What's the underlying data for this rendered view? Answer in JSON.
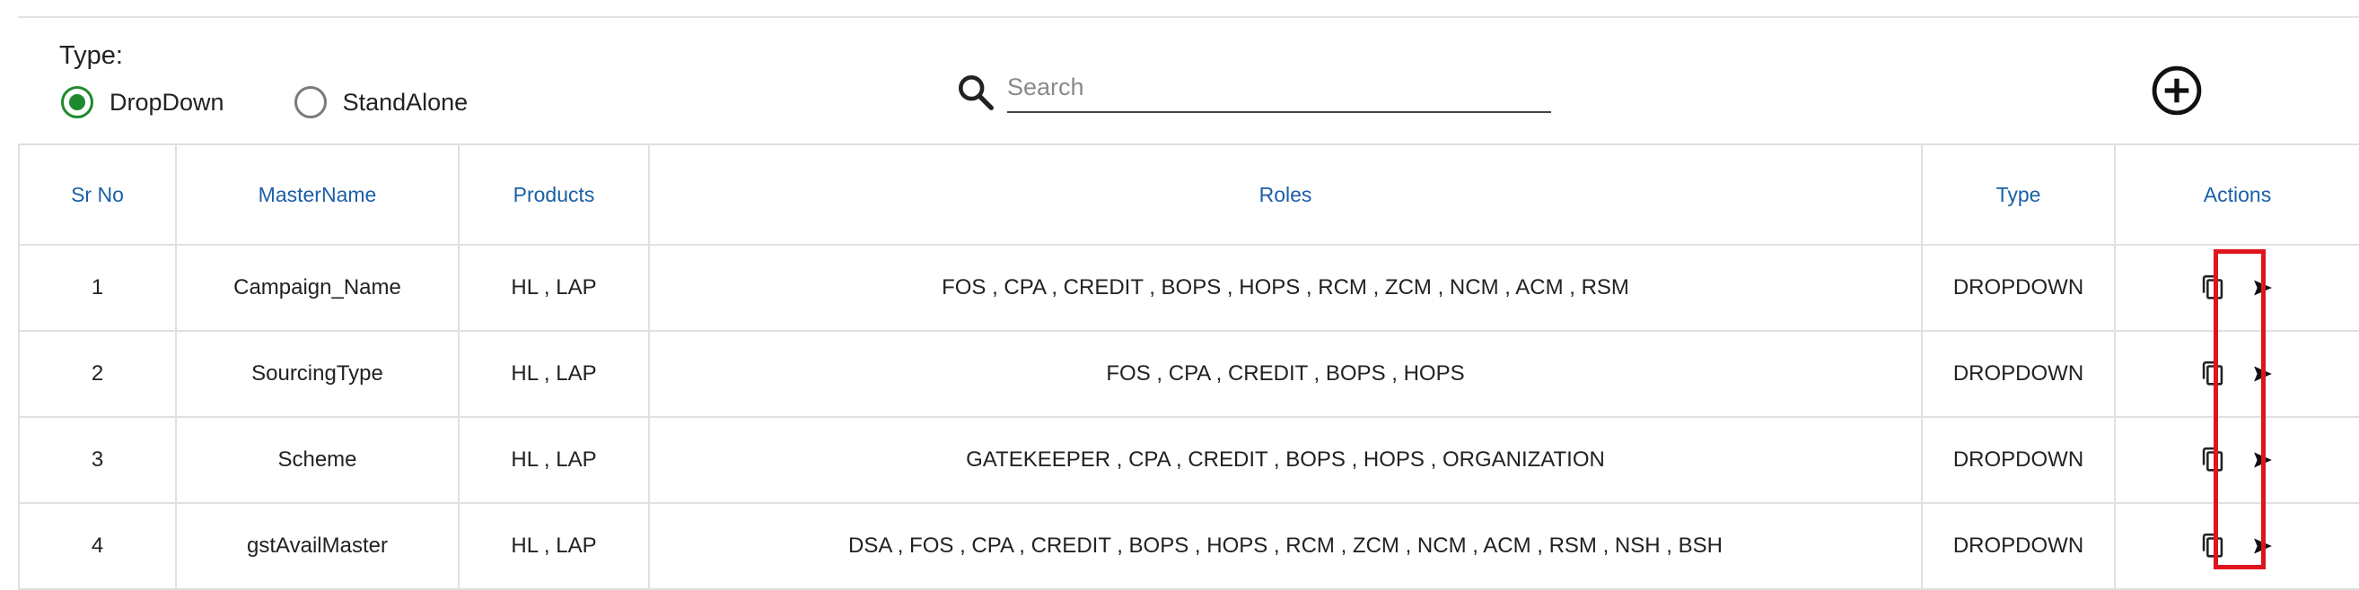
{
  "type_filter": {
    "label": "Type:",
    "options": [
      {
        "label": "DropDown",
        "checked": true
      },
      {
        "label": "StandAlone",
        "checked": false
      }
    ]
  },
  "search": {
    "placeholder": "Search",
    "value": ""
  },
  "table": {
    "headers": [
      "Sr No",
      "MasterName",
      "Products",
      "Roles",
      "Type",
      "Actions"
    ],
    "rows": [
      {
        "sr": "1",
        "master": "Campaign_Name",
        "products": "HL , LAP",
        "roles": "FOS , CPA , CREDIT , BOPS , HOPS , RCM , ZCM , NCM , ACM , RSM",
        "type": "DROPDOWN"
      },
      {
        "sr": "2",
        "master": "SourcingType",
        "products": "HL , LAP",
        "roles": "FOS , CPA , CREDIT , BOPS , HOPS",
        "type": "DROPDOWN"
      },
      {
        "sr": "3",
        "master": "Scheme",
        "products": "HL , LAP",
        "roles": "GATEKEEPER , CPA , CREDIT , BOPS , HOPS , ORGANIZATION",
        "type": "DROPDOWN"
      },
      {
        "sr": "4",
        "master": "gstAvailMaster",
        "products": "HL , LAP",
        "roles": "DSA , FOS , CPA , CREDIT , BOPS , HOPS , RCM , ZCM , NCM , ACM , RSM , NSH , BSH",
        "type": "DROPDOWN"
      }
    ]
  },
  "icons": {
    "search": "search-icon",
    "add": "add-circle-icon",
    "copy": "copy-icon",
    "send": "send-icon"
  },
  "colors": {
    "header_text": "#1b5fa6",
    "radio_selected": "#1e8a2e",
    "highlight": "#e0141e"
  }
}
